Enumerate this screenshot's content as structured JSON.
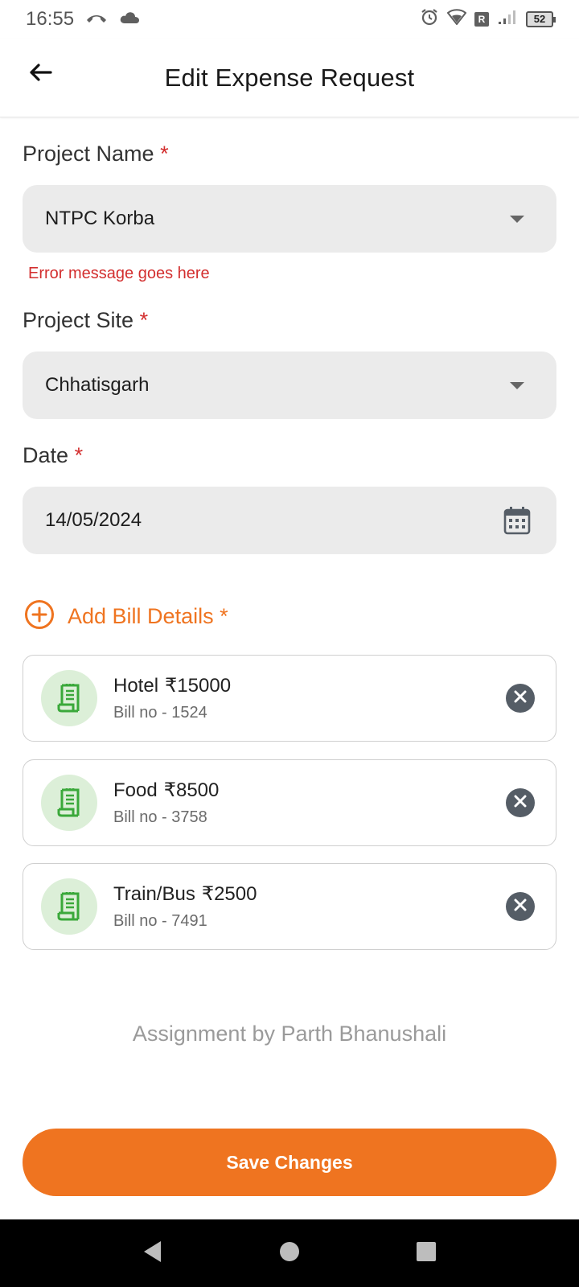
{
  "status_bar": {
    "time": "16:55",
    "battery": "52",
    "roaming_badge": "R",
    "icons": [
      "missed-call-icon",
      "cloud-icon",
      "alarm-icon",
      "wifi-icon",
      "signal-icon",
      "battery-icon"
    ]
  },
  "app_bar": {
    "title": "Edit Expense Request",
    "back_icon": "arrow-left-icon"
  },
  "form": {
    "project_name": {
      "label": "Project Name",
      "required_mark": "*",
      "value": "NTPC Korba",
      "error": "Error message goes here"
    },
    "project_site": {
      "label": "Project Site",
      "required_mark": "*",
      "value": "Chhatisgarh"
    },
    "date": {
      "label": "Date",
      "required_mark": "*",
      "value": "14/05/2024"
    },
    "add_bill": {
      "label": "Add Bill Details",
      "required_mark": "*"
    }
  },
  "bills": [
    {
      "category": "Hotel",
      "amount": "₹15000",
      "bill_no": "Bill no - 1524"
    },
    {
      "category": "Food",
      "amount": "₹8500",
      "bill_no": "Bill no - 3758"
    },
    {
      "category": "Train/Bus",
      "amount": "₹2500",
      "bill_no": "Bill no - 7491"
    }
  ],
  "footer": {
    "credit": "Assignment by Parth Bhanushali",
    "save_label": "Save Changes"
  },
  "colors": {
    "accent": "#ef7420",
    "error": "#d32f2f",
    "field_bg": "#ebebeb",
    "bill_icon_bg": "#dcefd8",
    "bill_icon": "#3aa83a"
  }
}
